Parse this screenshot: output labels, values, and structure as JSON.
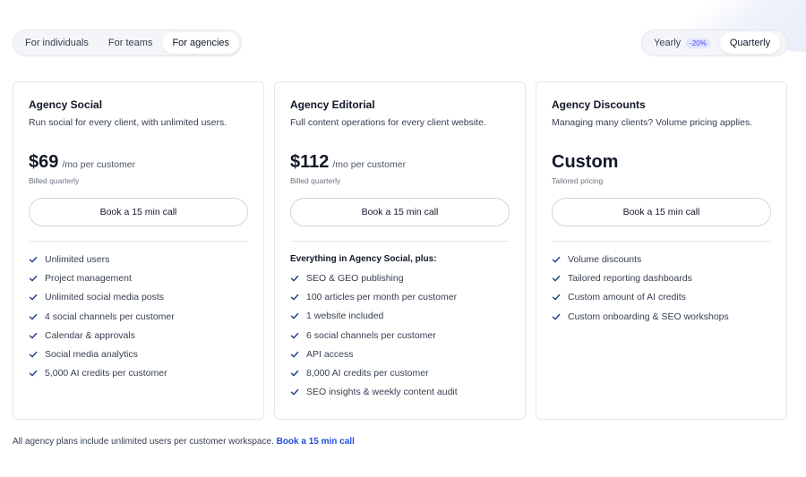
{
  "audience_tabs": [
    {
      "label": "For individuals",
      "active": false
    },
    {
      "label": "For teams",
      "active": false
    },
    {
      "label": "For agencies",
      "active": true
    }
  ],
  "billing": {
    "yearly_label": "Yearly",
    "yearly_badge": "-20%",
    "quarterly_label": "Quarterly",
    "selected": "Quarterly"
  },
  "plans": [
    {
      "title": "Agency Social",
      "description": "Run social for every client, with unlimited users.",
      "price": "$69",
      "per": "/mo per customer",
      "billing_note": "Billed quarterly",
      "cta": "Book a 15 min call",
      "features_heading": "",
      "features": [
        "Unlimited users",
        "Project management",
        "Unlimited social media posts",
        "4 social channels per customer",
        "Calendar & approvals",
        "Social media analytics",
        "5,000 AI credits per customer"
      ]
    },
    {
      "title": "Agency Editorial",
      "description": "Full content operations for every client website.",
      "price": "$112",
      "per": "/mo per customer",
      "billing_note": "Billed quarterly",
      "cta": "Book a 15 min call",
      "features_heading": "Everything in Agency Social, plus:",
      "features": [
        "SEO & GEO publishing",
        "100 articles per month per customer",
        "1 website included",
        "6 social channels per customer",
        "API access",
        "8,000 AI credits per customer",
        "SEO insights & weekly content audit"
      ]
    },
    {
      "title": "Agency Discounts",
      "description": "Managing many clients? Volume pricing applies.",
      "price": "Custom",
      "per": "",
      "billing_note": "Tailored pricing",
      "cta": "Book a 15 min call",
      "features_heading": "",
      "features": [
        "Volume discounts",
        "Tailored reporting dashboards",
        "Custom amount of AI credits",
        "Custom onboarding & SEO workshops"
      ]
    }
  ],
  "footer": {
    "text": "All agency plans include unlimited users per customer workspace.",
    "link": "Book a 15 min call"
  },
  "colors": {
    "check": "#1e3a8a",
    "link": "#1d4ed8",
    "badge_bg": "#e0e7ff",
    "badge_text": "#4f46e5"
  }
}
